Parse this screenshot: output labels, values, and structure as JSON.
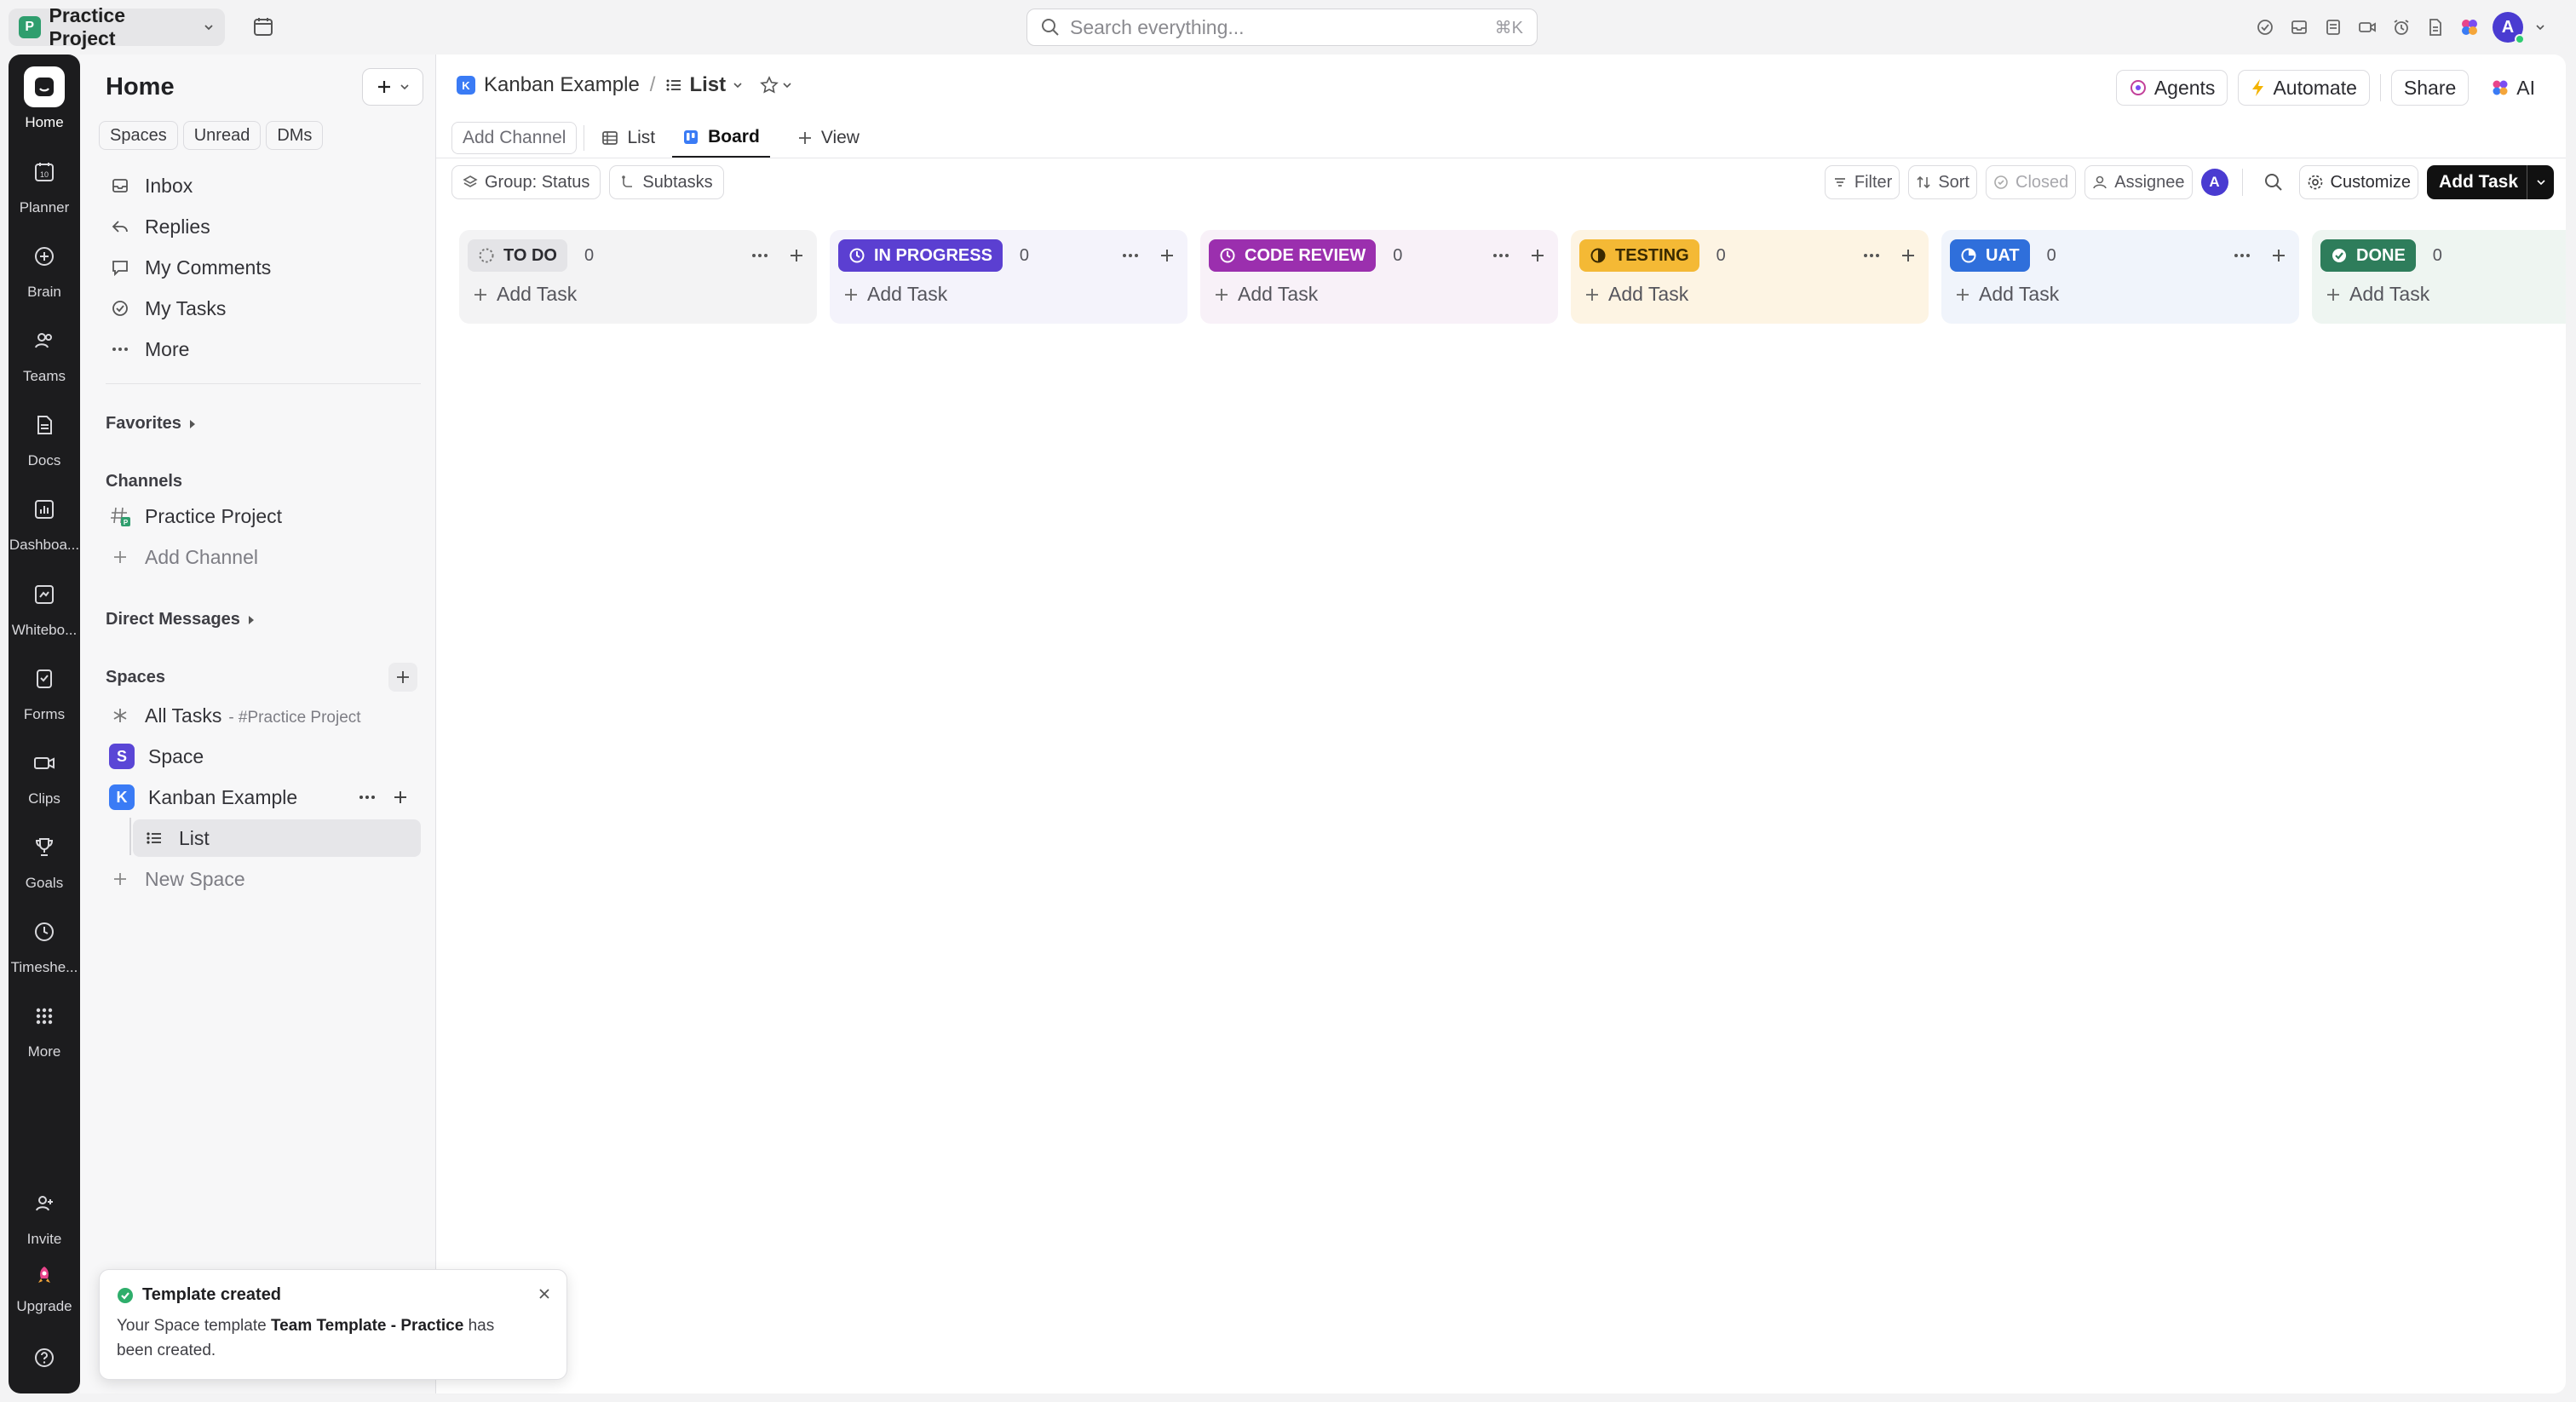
{
  "topbar": {
    "workspace_initial": "P",
    "workspace_name": "Practice Project",
    "search_placeholder": "Search everything...",
    "search_shortcut": "⌘K",
    "avatar_initial": "A"
  },
  "rail": {
    "items": [
      {
        "label": "Home",
        "icon": "home-icon"
      },
      {
        "label": "Planner",
        "icon": "calendar-icon"
      },
      {
        "label": "Brain",
        "icon": "brain-icon"
      },
      {
        "label": "Teams",
        "icon": "teams-icon"
      },
      {
        "label": "Docs",
        "icon": "doc-icon"
      },
      {
        "label": "Dashboa...",
        "icon": "dashboard-icon"
      },
      {
        "label": "Whitebo...",
        "icon": "whiteboard-icon"
      },
      {
        "label": "Forms",
        "icon": "forms-icon"
      },
      {
        "label": "Clips",
        "icon": "clips-icon"
      },
      {
        "label": "Goals",
        "icon": "trophy-icon"
      },
      {
        "label": "Timeshe...",
        "icon": "clock-icon"
      },
      {
        "label": "More",
        "icon": "grid-icon"
      }
    ],
    "invite_label": "Invite",
    "upgrade_label": "Upgrade"
  },
  "sidebar": {
    "title": "Home",
    "tabs": [
      "Spaces",
      "Unread",
      "DMs"
    ],
    "nav": [
      "Inbox",
      "Replies",
      "My Comments",
      "My Tasks",
      "More"
    ],
    "favorites_label": "Favorites",
    "channels_label": "Channels",
    "channel_name": "Practice Project",
    "add_channel_label": "Add Channel",
    "direct_messages_label": "Direct Messages",
    "spaces_label": "Spaces",
    "all_tasks_label": "All Tasks",
    "all_tasks_suffix": "- #Practice Project",
    "space_items": [
      {
        "initial": "S",
        "label": "Space",
        "color": "#5a46d6"
      },
      {
        "initial": "K",
        "label": "Kanban Example",
        "color": "#3a7bf5"
      }
    ],
    "list_label": "List",
    "new_space_label": "New Space"
  },
  "header": {
    "breadcrumb_space_initial": "K",
    "breadcrumb_space": "Kanban Example",
    "breadcrumb_sep": "/",
    "breadcrumb_list": "List",
    "agents_label": "Agents",
    "automate_label": "Automate",
    "share_label": "Share",
    "ai_label": "AI"
  },
  "view_tabs": {
    "add_channel": "Add Channel",
    "list": "List",
    "board": "Board",
    "view": "View"
  },
  "toolbar": {
    "group_label": "Group: Status",
    "subtasks_label": "Subtasks",
    "filter_label": "Filter",
    "sort_label": "Sort",
    "closed_label": "Closed",
    "assignee_label": "Assignee",
    "assignee_initial": "A",
    "customize_label": "Customize",
    "add_task_label": "Add Task"
  },
  "board": {
    "add_task_label": "Add Task",
    "columns": [
      {
        "name": "TO DO",
        "count": "0",
        "bg": "#f3f3f4",
        "pill_bg": "#e4e4e7",
        "pill_fg": "#2b2b30"
      },
      {
        "name": "IN PROGRESS",
        "count": "0",
        "bg": "#f4f3fb",
        "pill_bg": "#5b3fd1",
        "pill_fg": "#ffffff"
      },
      {
        "name": "CODE REVIEW",
        "count": "0",
        "bg": "#f8f1f8",
        "pill_bg": "#9b2fae",
        "pill_fg": "#ffffff"
      },
      {
        "name": "TESTING",
        "count": "0",
        "bg": "#fdf4e3",
        "pill_bg": "#f4b935",
        "pill_fg": "#3a2a00"
      },
      {
        "name": "UAT",
        "count": "0",
        "bg": "#f0f4fb",
        "pill_bg": "#2f6fdb",
        "pill_fg": "#ffffff"
      },
      {
        "name": "DONE",
        "count": "0",
        "bg": "#eef5f1",
        "pill_bg": "#2e7d5b",
        "pill_fg": "#ffffff"
      }
    ]
  },
  "toast": {
    "title": "Template created",
    "body_prefix": "Your Space template ",
    "body_bold": "Team Template - Practice",
    "body_suffix": " has been created."
  }
}
